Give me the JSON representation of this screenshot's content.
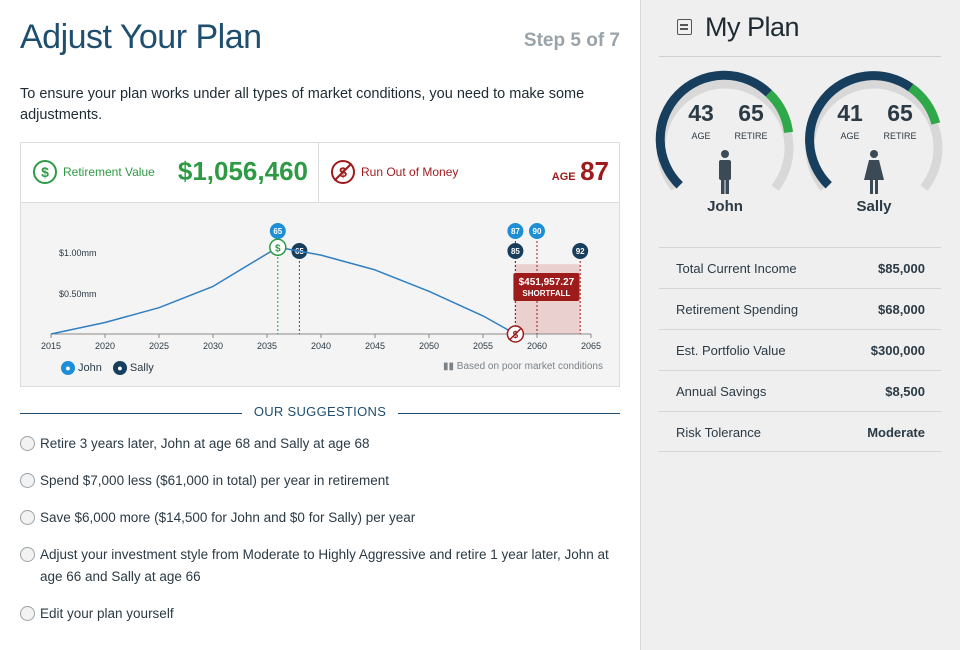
{
  "header": {
    "title": "Adjust Your Plan",
    "step": "Step 5 of 7"
  },
  "intro": "To ensure your plan works under all types of market conditions, you need to make some adjustments.",
  "summary": {
    "retirement_label": "Retirement Value",
    "retirement_value": "$1,056,460",
    "run_out_label": "Run Out of Money",
    "age_prefix": "AGE",
    "age_value": "87"
  },
  "chart_data": {
    "type": "line",
    "x": [
      2015,
      2020,
      2025,
      2030,
      2036,
      2040,
      2045,
      2050,
      2055,
      2058
    ],
    "y": [
      0.0,
      0.14,
      0.32,
      0.58,
      1.056,
      0.96,
      0.78,
      0.52,
      0.22,
      0.0
    ],
    "xticks": [
      "2015",
      "2020",
      "2025",
      "2030",
      "2035",
      "2040",
      "2045",
      "2050",
      "2055",
      "2060",
      "2065"
    ],
    "yticks": [
      "$1.00mm",
      "$0.50mm"
    ],
    "xlim": [
      2015,
      2065
    ],
    "ylim": [
      0,
      1.4
    ],
    "markers": [
      {
        "label": "65",
        "year": 2036,
        "who": "john",
        "level": 1
      },
      {
        "label": "65",
        "year": 2038,
        "who": "sally",
        "level": 2
      },
      {
        "label": "87",
        "year": 2058,
        "who": "john",
        "level": 1
      },
      {
        "label": "90",
        "year": 2060,
        "who": "john",
        "level": 1
      },
      {
        "label": "85",
        "year": 2058,
        "who": "sally",
        "level": 2
      },
      {
        "label": "92",
        "year": 2064,
        "who": "sally",
        "level": 2
      }
    ],
    "shortfall": {
      "amount": "$451,957.27",
      "label": "SHORTFALL",
      "from": 2058,
      "to": 2064
    },
    "legend": [
      "John",
      "Sally"
    ],
    "note": "Based on poor market conditions",
    "colors": {
      "line": "#2f7fc1",
      "john": "#1e8fd6",
      "sally": "#173e5c",
      "green": "#2e9b44",
      "red": "#9e1b1b"
    }
  },
  "suggestions": {
    "heading": "OUR SUGGESTIONS",
    "items": [
      "Retire 3 years later, John at age 68 and Sally at age 68",
      "Spend $7,000 less ($61,000 in total) per year in retirement",
      "Save $6,000 more ($14,500 for John and $0 for Sally) per year",
      "Adjust your investment style from Moderate to Highly Aggressive and retire 1 year later, John at age 66 and Sally at age 66",
      "Edit your plan yourself"
    ]
  },
  "sidebar": {
    "title": "My Plan",
    "people": [
      {
        "name": "John",
        "age": "43",
        "retire": "65",
        "age_label": "AGE",
        "retire_label": "RETIRE",
        "progress": 0.66
      },
      {
        "name": "Sally",
        "age": "41",
        "retire": "65",
        "age_label": "AGE",
        "retire_label": "RETIRE",
        "progress": 0.63
      }
    ],
    "stats": [
      {
        "label": "Total Current Income",
        "value": "$85,000"
      },
      {
        "label": "Retirement Spending",
        "value": "$68,000"
      },
      {
        "label": "Est. Portfolio Value",
        "value": "$300,000"
      },
      {
        "label": "Annual Savings",
        "value": "$8,500"
      },
      {
        "label": "Risk Tolerance",
        "value": "Moderate"
      }
    ]
  }
}
